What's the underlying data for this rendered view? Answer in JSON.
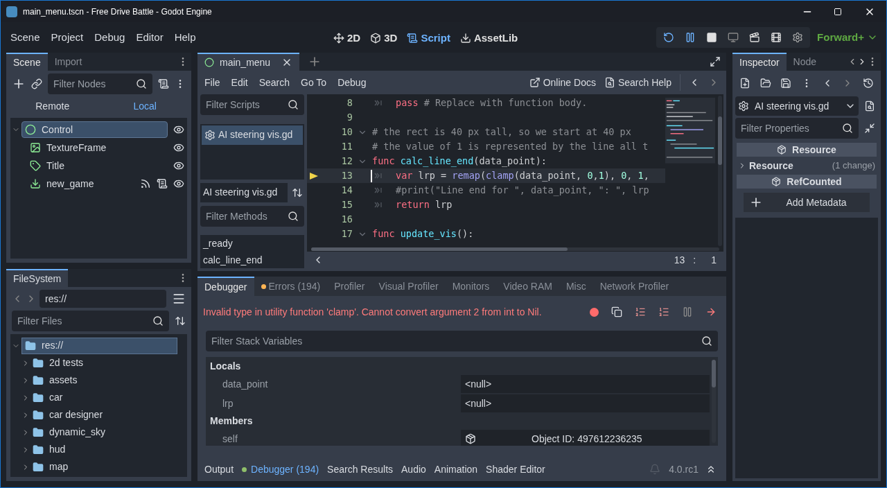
{
  "window": {
    "title": "main_menu.tscn - Free Drive Battle - Godot Engine"
  },
  "menu": [
    "Scene",
    "Project",
    "Debug",
    "Editor",
    "Help"
  ],
  "workspaces": [
    {
      "label": "2D",
      "selected": false
    },
    {
      "label": "3D",
      "selected": false
    },
    {
      "label": "Script",
      "selected": true
    },
    {
      "label": "AssetLib",
      "selected": false
    }
  ],
  "renderer": "Forward+",
  "scene_dock": {
    "tabs": [
      {
        "label": "Scene",
        "selected": true
      },
      {
        "label": "Import",
        "selected": false
      }
    ],
    "filter_placeholder": "Filter Nodes",
    "modes": [
      {
        "label": "Remote",
        "selected": false
      },
      {
        "label": "Local",
        "selected": true
      }
    ],
    "tree": {
      "label": "Control",
      "kind": "control",
      "selected": true,
      "expanded": true,
      "children": [
        {
          "label": "TextureFrame",
          "kind": "texture",
          "selected": false,
          "signals": false,
          "script": false
        },
        {
          "label": "Title",
          "kind": "label",
          "selected": false,
          "signals": false,
          "script": false
        },
        {
          "label": "new_game",
          "kind": "button",
          "selected": false,
          "signals": true,
          "script": true
        }
      ]
    }
  },
  "filesystem": {
    "tab": "FileSystem",
    "path": "res://",
    "filter_placeholder": "Filter Files",
    "root": {
      "label": "res://",
      "selected": true,
      "expanded": true,
      "children": [
        {
          "label": "2d tests",
          "expanded": false
        },
        {
          "label": "assets",
          "expanded": false
        },
        {
          "label": "car",
          "expanded": false
        },
        {
          "label": "car designer",
          "expanded": false
        },
        {
          "label": "dynamic_sky",
          "expanded": false
        },
        {
          "label": "hud",
          "expanded": false
        },
        {
          "label": "map",
          "expanded": false
        }
      ]
    }
  },
  "script_editor": {
    "open_tab": "main_menu",
    "menu": [
      "File",
      "Edit",
      "Search",
      "Go To",
      "Debug"
    ],
    "help_links": [
      "Online Docs",
      "Search Help"
    ],
    "filter_scripts_placeholder": "Filter Scripts",
    "scripts": [
      {
        "label": "AI steering vis.gd",
        "selected": true
      }
    ],
    "current_script": "AI steering vis.gd",
    "filter_methods_placeholder": "Filter Methods",
    "methods": [
      "_ready",
      "calc_line_end"
    ],
    "lines": [
      {
        "number": "8",
        "fold": false,
        "indent": true,
        "current": false,
        "segments": [
          {
            "kind": "keyword",
            "text": "pass"
          },
          {
            "kind": "comment",
            "text": " # Replace with function body."
          }
        ]
      },
      {
        "number": "9",
        "fold": false,
        "indent": false,
        "current": false
      },
      {
        "number": "10",
        "fold": true,
        "indent": false,
        "current": false,
        "segments": [
          {
            "kind": "comment",
            "text": "# the rect is 40 px tall, so we start at 40 px"
          }
        ]
      },
      {
        "number": "11",
        "fold": false,
        "indent": false,
        "current": false,
        "segments": [
          {
            "kind": "comment",
            "text": "# the value of 1 is represented by the line all t"
          }
        ]
      },
      {
        "number": "12",
        "fold": true,
        "indent": false,
        "current": false,
        "segments": [
          {
            "kind": "keyword",
            "text": "func "
          },
          {
            "kind": "function",
            "text": "calc_line_end"
          },
          {
            "kind": "plain",
            "text": "(data_point):"
          }
        ]
      },
      {
        "number": "13",
        "fold": false,
        "indent": true,
        "current": true,
        "segments": [
          {
            "kind": "keyword",
            "text": "var"
          },
          {
            "kind": "plain",
            "text": " lrp = "
          },
          {
            "kind": "call",
            "text": "remap"
          },
          {
            "kind": "plain",
            "text": "("
          },
          {
            "kind": "call",
            "text": "clamp"
          },
          {
            "kind": "plain",
            "text": "(data_point, "
          },
          {
            "kind": "number",
            "text": "0"
          },
          {
            "kind": "plain",
            "text": ","
          },
          {
            "kind": "number",
            "text": "1"
          },
          {
            "kind": "plain",
            "text": "), "
          },
          {
            "kind": "number",
            "text": "0"
          },
          {
            "kind": "plain",
            "text": ", "
          },
          {
            "kind": "number",
            "text": "1"
          },
          {
            "kind": "plain",
            "text": ","
          }
        ]
      },
      {
        "number": "14",
        "fold": false,
        "indent": true,
        "current": false,
        "segments": [
          {
            "kind": "comment",
            "text": "#print(\"Line end for \", data_point, \": \", lrp"
          }
        ]
      },
      {
        "number": "15",
        "fold": false,
        "indent": true,
        "current": false,
        "segments": [
          {
            "kind": "keyword",
            "text": "return"
          },
          {
            "kind": "plain",
            "text": " lrp"
          }
        ]
      },
      {
        "number": "16",
        "fold": false,
        "indent": false,
        "current": false
      },
      {
        "number": "17",
        "fold": true,
        "indent": false,
        "current": false,
        "segments": [
          {
            "kind": "keyword",
            "text": "func "
          },
          {
            "kind": "function",
            "text": "update_vis"
          },
          {
            "kind": "plain",
            "text": "():"
          }
        ]
      }
    ],
    "cursor": {
      "line": "13",
      "separator": ":",
      "column": "1"
    }
  },
  "debugger": {
    "tabs": [
      {
        "label": "Debugger",
        "selected": true,
        "alert": false
      },
      {
        "label": "Errors (194)",
        "selected": false,
        "alert": true
      },
      {
        "label": "Profiler",
        "selected": false,
        "alert": false
      },
      {
        "label": "Visual Profiler",
        "selected": false,
        "alert": false
      },
      {
        "label": "Monitors",
        "selected": false,
        "alert": false
      },
      {
        "label": "Video RAM",
        "selected": false,
        "alert": false
      },
      {
        "label": "Misc",
        "selected": false,
        "alert": false
      },
      {
        "label": "Network Profiler",
        "selected": false,
        "alert": false
      }
    ],
    "error": "Invalid type in utility function 'clamp'. Cannot convert argument 2 from int to Nil.",
    "filter_placeholder": "Filter Stack Variables",
    "sections": [
      {
        "title": "Locals",
        "variables": [
          {
            "name": "data_point",
            "value": "<null>",
            "kind": "value"
          },
          {
            "name": "lrp",
            "value": "<null>",
            "kind": "value"
          }
        ]
      },
      {
        "title": "Members",
        "variables": [
          {
            "name": "self",
            "value": "Object ID: 497612236235",
            "kind": "object"
          }
        ]
      }
    ]
  },
  "bottom_tabs": [
    {
      "label": "Output",
      "selected": false,
      "alert": false
    },
    {
      "label": "Debugger (194)",
      "selected": true,
      "alert": true
    },
    {
      "label": "Search Results",
      "selected": false,
      "alert": false
    },
    {
      "label": "Audio",
      "selected": false,
      "alert": false
    },
    {
      "label": "Animation",
      "selected": false,
      "alert": false
    },
    {
      "label": "Shader Editor",
      "selected": false,
      "alert": false
    }
  ],
  "version": "4.0.rc1",
  "inspector": {
    "tabs": [
      {
        "label": "Inspector",
        "selected": true
      },
      {
        "label": "Node",
        "selected": false
      }
    ],
    "object": "AI steering vis.gd",
    "filter_placeholder": "Filter Properties",
    "rows": [
      {
        "kind": "category",
        "label": "Resource"
      },
      {
        "kind": "property",
        "label": "Resource",
        "note": "(1 change)"
      },
      {
        "kind": "category",
        "label": "RefCounted"
      }
    ],
    "add_button": "Add Metadata"
  }
}
